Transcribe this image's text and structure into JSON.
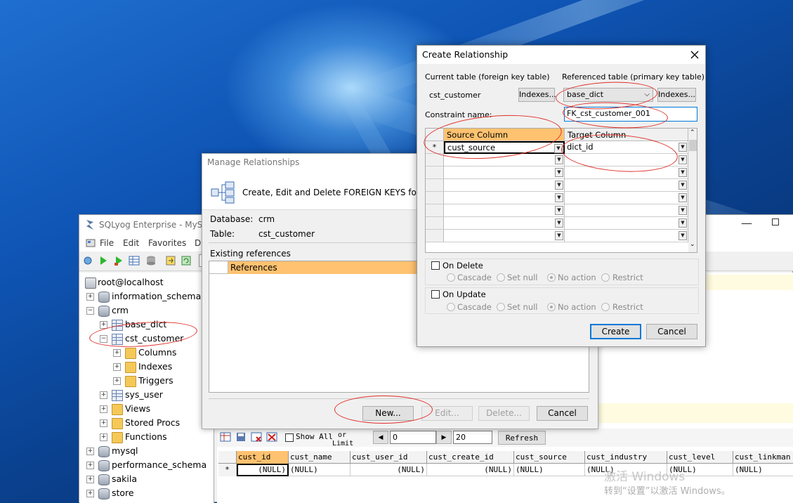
{
  "sqlyog": {
    "title": "SQLyog Enterprise - MyS",
    "menu": [
      "File",
      "Edit",
      "Favorites",
      "D"
    ],
    "tree": {
      "server": "root@localhost",
      "dbs": [
        "information_schema",
        "crm",
        "mysql",
        "performance_schema",
        "sakila",
        "store"
      ],
      "crm_children": [
        "base_dict",
        "cst_customer",
        "sys_user"
      ],
      "cst_customer_children": [
        "Columns",
        "Indexes",
        "Triggers"
      ],
      "crm_folders": [
        "Views",
        "Stored Procs",
        "Functions"
      ]
    },
    "result_toolbar": {
      "show_all": "Show All",
      "or_limit_1": "or",
      "or_limit_2": "Limit",
      "offset": "0",
      "limit": "20",
      "refresh": "Refresh"
    },
    "grid": {
      "columns": [
        "cust_id",
        "cust_name",
        "cust_user_id",
        "cust_create_id",
        "cust_source",
        "cust_industry",
        "cust_level",
        "cust_linkman"
      ],
      "row_marker": "*",
      "null_value": "(NULL)"
    }
  },
  "manage": {
    "title": "Manage Relationships",
    "header_text": "Create, Edit and Delete FOREIGN KEYS for the sele",
    "database_label": "Database:",
    "database_value": "crm",
    "table_label": "Table:",
    "table_value": "cst_customer",
    "existing_refs": "Existing references",
    "refs_column": "References",
    "buttons": {
      "new": "New...",
      "edit": "Edit...",
      "delete": "Delete...",
      "cancel": "Cancel"
    }
  },
  "create": {
    "title": "Create Relationship",
    "current_table_label": "Current table (foreign key table)",
    "referenced_table_label": "Referenced table (primary key table)",
    "current_table": "cst_customer",
    "indexes_btn": "Indexes...",
    "referenced_table": "base_dict",
    "constraint_label": "Constraint name:",
    "constraint_value": "FK_cst_customer_001",
    "source_col_header": "Source Column",
    "target_col_header": "Target Column",
    "row_marker": "*",
    "source_value": "cust_source",
    "target_value": "dict_id",
    "on_delete": "On Delete",
    "on_update": "On Update",
    "options": [
      "Cascade",
      "Set null",
      "No action",
      "Restrict"
    ],
    "create_btn": "Create",
    "cancel_btn": "Cancel"
  },
  "watermark": {
    "line1": "激活 Windows",
    "line2": "转到“设置”以激活 Windows。"
  },
  "colors": {
    "orange_header": "#ffc270",
    "accent": "#0078d7",
    "annotation": "#e0302a"
  }
}
